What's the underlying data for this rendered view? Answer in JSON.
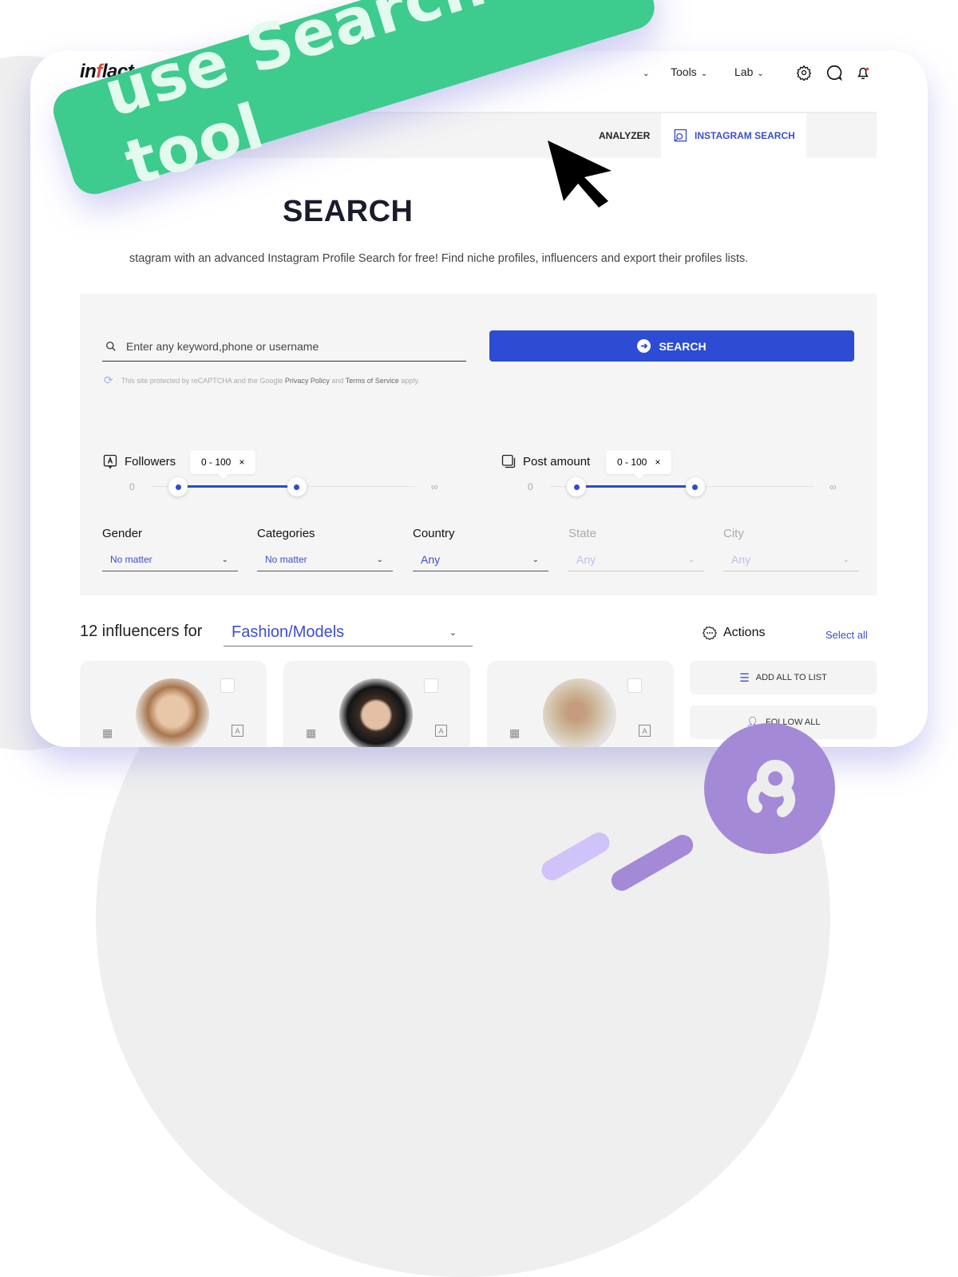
{
  "banner": {
    "text": "use Search tool"
  },
  "header": {
    "logo": "inflact",
    "nav": [
      {
        "label": "Tools"
      },
      {
        "label": "Lab"
      }
    ],
    "icons": [
      "gear-icon",
      "chat-icon",
      "bell-icon"
    ]
  },
  "tabs": {
    "items": [
      {
        "label": "ANALYZER",
        "active": false
      },
      {
        "label": "INSTAGRAM SEARCH",
        "active": true
      }
    ]
  },
  "page": {
    "title_visible": "SEARCH",
    "description_visible": "stagram with an advanced Instagram Profile Search for free! Find niche profiles, influencers and export their profiles lists."
  },
  "search": {
    "placeholder": "Enter any keyword,phone or username",
    "button_label": "SEARCH",
    "captcha": {
      "prefix": "This site protected by reCAPTCHA and the Google",
      "privacy": "Privacy Policy",
      "and": "and",
      "terms": "Terms of Service",
      "suffix": "apply."
    }
  },
  "ranges": [
    {
      "label": "Followers",
      "badge": "0 - 100",
      "close": "×",
      "min": "0",
      "max": "∞",
      "low": 0.1,
      "high": 0.55
    },
    {
      "label": "Post amount",
      "badge": "0 - 100",
      "close": "×",
      "min": "0",
      "max": "∞",
      "low": 0.1,
      "high": 0.55
    }
  ],
  "filters": [
    {
      "label": "Gender",
      "value": "No matter",
      "disabled": false
    },
    {
      "label": "Categories",
      "value": "No matter",
      "disabled": false
    },
    {
      "label": "Country",
      "value": "Any",
      "disabled": false
    },
    {
      "label": "State",
      "value": "Any",
      "disabled": true
    },
    {
      "label": "City",
      "value": "Any",
      "disabled": true
    }
  ],
  "results": {
    "count_label": "12 influencers for",
    "category": "Fashion/Models",
    "actions_label": "Actions",
    "select_all": "Select all",
    "add_all": "ADD ALL TO LIST",
    "follow_all": "FOLLOW ALL"
  },
  "colors": {
    "accent": "#2d4bd3",
    "banner": "#3ecb8e",
    "brand_purple": "#a389d6"
  }
}
